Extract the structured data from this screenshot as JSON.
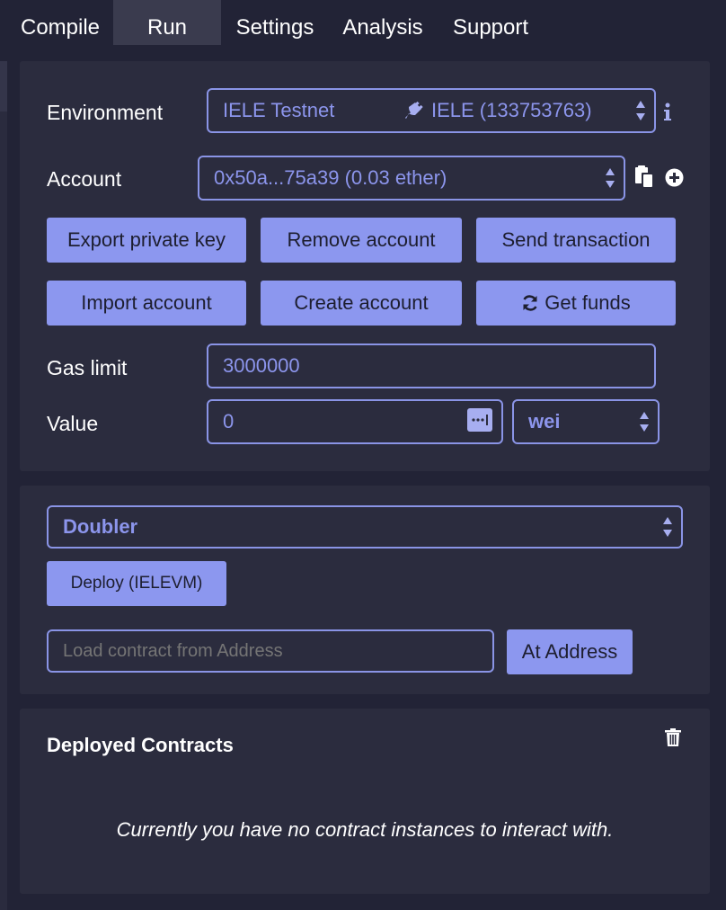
{
  "tabs": [
    {
      "label": "Compile"
    },
    {
      "label": "Run"
    },
    {
      "label": "Settings"
    },
    {
      "label": "Analysis"
    },
    {
      "label": "Support"
    }
  ],
  "run": {
    "environment_label": "Environment",
    "environment_value": "IELE Testnet",
    "environment_network": "IELE (133753763)",
    "account_label": "Account",
    "account_value": "0x50a...75a39 (0.03 ether)",
    "buttons": {
      "export_private_key": "Export private key",
      "remove_account": "Remove account",
      "send_transaction": "Send transaction",
      "import_account": "Import account",
      "create_account": "Create account",
      "get_funds": "Get funds"
    },
    "gas_limit_label": "Gas limit",
    "gas_limit_value": "3000000",
    "value_label": "Value",
    "value_value": "0",
    "value_unit": "wei"
  },
  "deploy": {
    "contract_selected": "Doubler",
    "deploy_button": "Deploy (IELEVM)",
    "address_placeholder": "Load contract from Address",
    "at_address_button": "At Address"
  },
  "deployed": {
    "title": "Deployed Contracts",
    "empty_message": "Currently you have no contract instances to interact with."
  },
  "colors": {
    "background": "#222336",
    "panel": "#2b2c3e",
    "accent": "#8c97ef",
    "field_text": "#8c95ec"
  }
}
